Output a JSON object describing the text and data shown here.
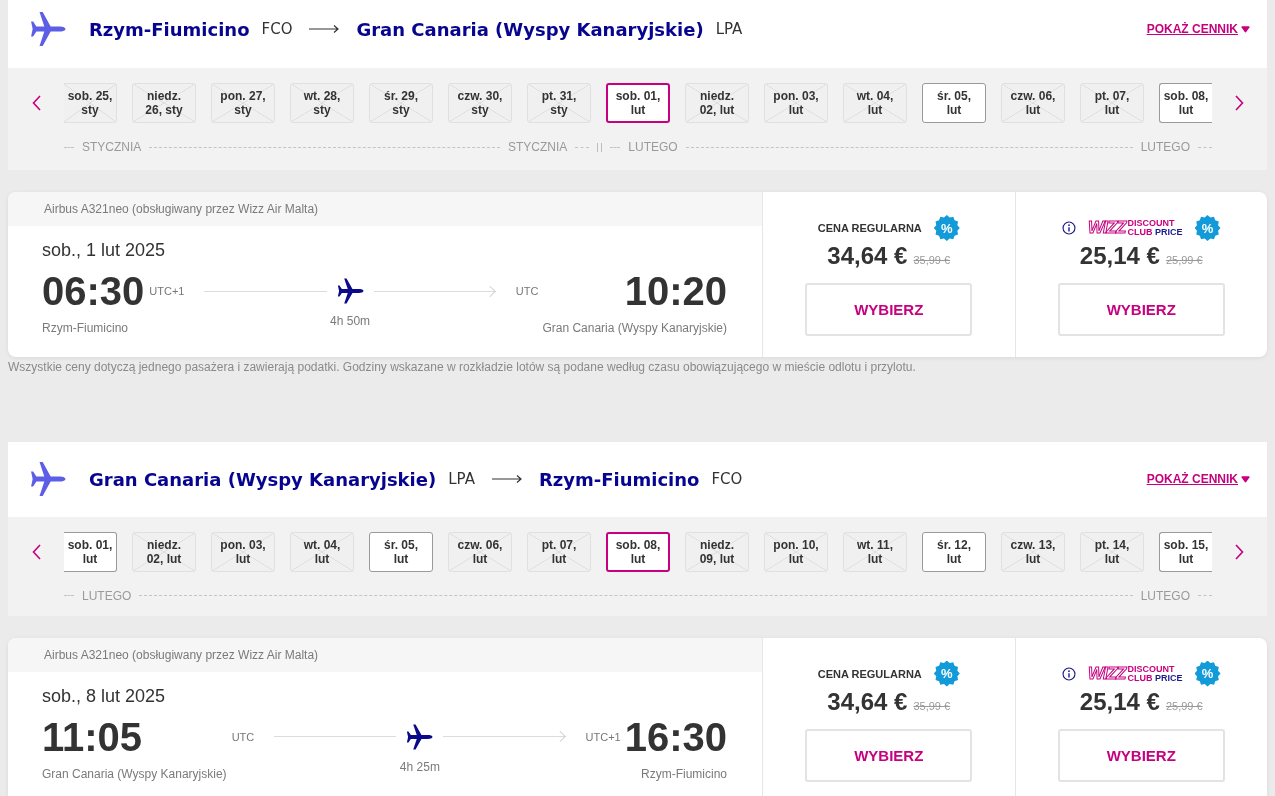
{
  "legs": [
    {
      "origin": {
        "name": "Rzym-Fiumicino",
        "code": "FCO"
      },
      "destination": {
        "name": "Gran Canaria (Wyspy Kanaryjskie)",
        "code": "LPA"
      },
      "price_list_link": "POKAŻ CENNIK",
      "months": [
        {
          "labels": [
            "STYCZNIA",
            "STYCZNIA"
          ],
          "days": [
            {
              "lines": [
                "sob. 25,",
                "sty"
              ],
              "selected": false,
              "disabled": true
            },
            {
              "lines": [
                "niedz.",
                "26, sty"
              ],
              "selected": false,
              "disabled": true
            },
            {
              "lines": [
                "pon. 27,",
                "sty"
              ],
              "selected": false,
              "disabled": true
            },
            {
              "lines": [
                "wt. 28,",
                "sty"
              ],
              "selected": false,
              "disabled": true
            },
            {
              "lines": [
                "śr. 29,",
                "sty"
              ],
              "selected": false,
              "disabled": true
            },
            {
              "lines": [
                "czw. 30,",
                "sty"
              ],
              "selected": false,
              "disabled": true
            },
            {
              "lines": [
                "pt. 31,",
                "sty"
              ],
              "selected": false,
              "disabled": true
            }
          ]
        },
        {
          "labels": [
            "LUTEGO",
            "LUTEGO"
          ],
          "days": [
            {
              "lines": [
                "sob. 01,",
                "lut"
              ],
              "selected": true,
              "disabled": false
            },
            {
              "lines": [
                "niedz.",
                "02, lut"
              ],
              "selected": false,
              "disabled": true
            },
            {
              "lines": [
                "pon. 03,",
                "lut"
              ],
              "selected": false,
              "disabled": true
            },
            {
              "lines": [
                "wt. 04,",
                "lut"
              ],
              "selected": false,
              "disabled": true
            },
            {
              "lines": [
                "śr. 05,",
                "lut"
              ],
              "selected": false,
              "disabled": false
            },
            {
              "lines": [
                "czw. 06,",
                "lut"
              ],
              "selected": false,
              "disabled": true
            },
            {
              "lines": [
                "pt. 07,",
                "lut"
              ],
              "selected": false,
              "disabled": true
            },
            {
              "lines": [
                "sob. 08,",
                "lut"
              ],
              "selected": false,
              "disabled": false
            }
          ]
        }
      ],
      "flight": {
        "aircraft": "Airbus A321neo (obsługiwany przez Wizz Air Malta)",
        "date": "sob., 1 lut 2025",
        "departure": {
          "time": "06:30",
          "timezone": "UTC+1",
          "airport": "Rzym-Fiumicino"
        },
        "duration": "4h 50m",
        "arrival": {
          "time": "10:20",
          "timezone": "UTC",
          "airport": "Gran Canaria (Wyspy Kanaryjskie)"
        },
        "fares": [
          {
            "kind": "regular",
            "label": "CENA REGULARNA",
            "badge": "%",
            "price": "34,64 €",
            "old_price": "35,99 €",
            "button": "WYBIERZ"
          },
          {
            "kind": "club",
            "logo": {
              "brand": "WIZZ",
              "tagline": [
                "DISCOUNT",
                "CLUB",
                "PRICE"
              ]
            },
            "badge": "%",
            "price": "25,14 €",
            "old_price": "25,99 €",
            "button": "WYBIERZ"
          }
        ]
      },
      "note": "Wszystkie ceny dotyczą jednego pasażera i zawierają podatki. Godziny wskazane w rozkładzie lotów są podane według czasu obowiązującego w mieście odlotu i przylotu."
    },
    {
      "origin": {
        "name": "Gran Canaria (Wyspy Kanaryjskie)",
        "code": "LPA"
      },
      "destination": {
        "name": "Rzym-Fiumicino",
        "code": "FCO"
      },
      "price_list_link": "POKAŻ CENNIK",
      "months": [
        {
          "labels": [
            "LUTEGO",
            "LUTEGO"
          ],
          "days": [
            {
              "lines": [
                "sob. 01,",
                "lut"
              ],
              "selected": false,
              "disabled": false
            },
            {
              "lines": [
                "niedz.",
                "02, lut"
              ],
              "selected": false,
              "disabled": true
            },
            {
              "lines": [
                "pon. 03,",
                "lut"
              ],
              "selected": false,
              "disabled": true
            },
            {
              "lines": [
                "wt. 04,",
                "lut"
              ],
              "selected": false,
              "disabled": true
            },
            {
              "lines": [
                "śr. 05,",
                "lut"
              ],
              "selected": false,
              "disabled": false
            },
            {
              "lines": [
                "czw. 06,",
                "lut"
              ],
              "selected": false,
              "disabled": true
            },
            {
              "lines": [
                "pt. 07,",
                "lut"
              ],
              "selected": false,
              "disabled": true
            },
            {
              "lines": [
                "sob. 08,",
                "lut"
              ],
              "selected": true,
              "disabled": false
            },
            {
              "lines": [
                "niedz.",
                "09, lut"
              ],
              "selected": false,
              "disabled": true
            },
            {
              "lines": [
                "pon. 10,",
                "lut"
              ],
              "selected": false,
              "disabled": true
            },
            {
              "lines": [
                "wt. 11,",
                "lut"
              ],
              "selected": false,
              "disabled": true
            },
            {
              "lines": [
                "śr. 12,",
                "lut"
              ],
              "selected": false,
              "disabled": false
            },
            {
              "lines": [
                "czw. 13,",
                "lut"
              ],
              "selected": false,
              "disabled": true
            },
            {
              "lines": [
                "pt. 14,",
                "lut"
              ],
              "selected": false,
              "disabled": true
            },
            {
              "lines": [
                "sob. 15,",
                "lut"
              ],
              "selected": false,
              "disabled": false
            }
          ]
        }
      ],
      "flight": {
        "aircraft": "Airbus A321neo (obsługiwany przez Wizz Air Malta)",
        "date": "sob., 8 lut 2025",
        "departure": {
          "time": "11:05",
          "timezone": "UTC",
          "airport": "Gran Canaria (Wyspy Kanaryjskie)"
        },
        "duration": "4h 25m",
        "arrival": {
          "time": "16:30",
          "timezone": "UTC+1",
          "airport": "Rzym-Fiumicino"
        },
        "fares": [
          {
            "kind": "regular",
            "label": "CENA REGULARNA",
            "badge": "%",
            "price": "34,64 €",
            "old_price": "35,99 €",
            "button": "WYBIERZ"
          },
          {
            "kind": "club",
            "logo": {
              "brand": "WIZZ",
              "tagline": [
                "DISCOUNT",
                "CLUB",
                "PRICE"
              ]
            },
            "badge": "%",
            "price": "25,14 €",
            "old_price": "25,99 €",
            "button": "WYBIERZ"
          }
        ]
      }
    }
  ]
}
